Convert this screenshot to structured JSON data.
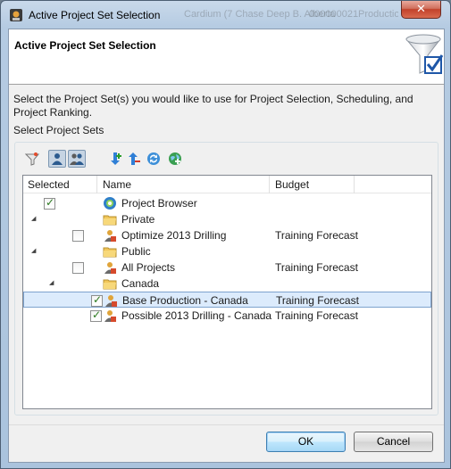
{
  "window": {
    "title": "Active Project Set Selection",
    "close_glyph": "✕",
    "background_text": [
      "Cardium (7 Chase Deep B. Alberta",
      "000000021",
      "Production"
    ]
  },
  "header": {
    "title": "Active Project Set Selection",
    "icon": "funnel-check-icon"
  },
  "description": "Select the Project Set(s) you would like to use for Project Selection, Scheduling, and Project Ranking.",
  "group_label": "Select Project Sets",
  "toolbar": {
    "buttons": [
      {
        "icon": "filter-icon"
      },
      {
        "icon": "user-view-icon",
        "pressed": true
      },
      {
        "icon": "users-view-icon",
        "pressed": true
      },
      {
        "icon": "move-down-add-icon"
      },
      {
        "icon": "move-up-remove-icon"
      },
      {
        "icon": "refresh-icon"
      },
      {
        "icon": "add-globe-icon"
      }
    ]
  },
  "table": {
    "columns": [
      "Selected",
      "Name",
      "Budget"
    ],
    "rows": [
      {
        "level": 0,
        "type": "browser",
        "name": "Project Browser",
        "checked": true,
        "budget": ""
      },
      {
        "level": 0,
        "type": "folder",
        "name": "Private",
        "expanded": true
      },
      {
        "level": 1,
        "type": "set",
        "name": "Optimize 2013 Drilling",
        "checked": false,
        "budget": "Training Forecast"
      },
      {
        "level": 0,
        "type": "folder",
        "name": "Public",
        "expanded": true
      },
      {
        "level": 1,
        "type": "set",
        "name": "All Projects",
        "checked": false,
        "budget": "Training Forecast"
      },
      {
        "level": 1,
        "type": "folder",
        "name": "Canada",
        "expanded": true
      },
      {
        "level": 2,
        "type": "set",
        "name": "Base Production - Canada",
        "checked": true,
        "budget": "Training Forecast",
        "selected": true
      },
      {
        "level": 2,
        "type": "set",
        "name": "Possible 2013 Drilling - Canada",
        "checked": true,
        "budget": "Training Forecast"
      }
    ]
  },
  "buttons": {
    "ok": "OK",
    "cancel": "Cancel"
  },
  "colors": {
    "selection": "#dcebfc",
    "check": "#2b7a1e",
    "title_bg": "#b5cbe2"
  }
}
